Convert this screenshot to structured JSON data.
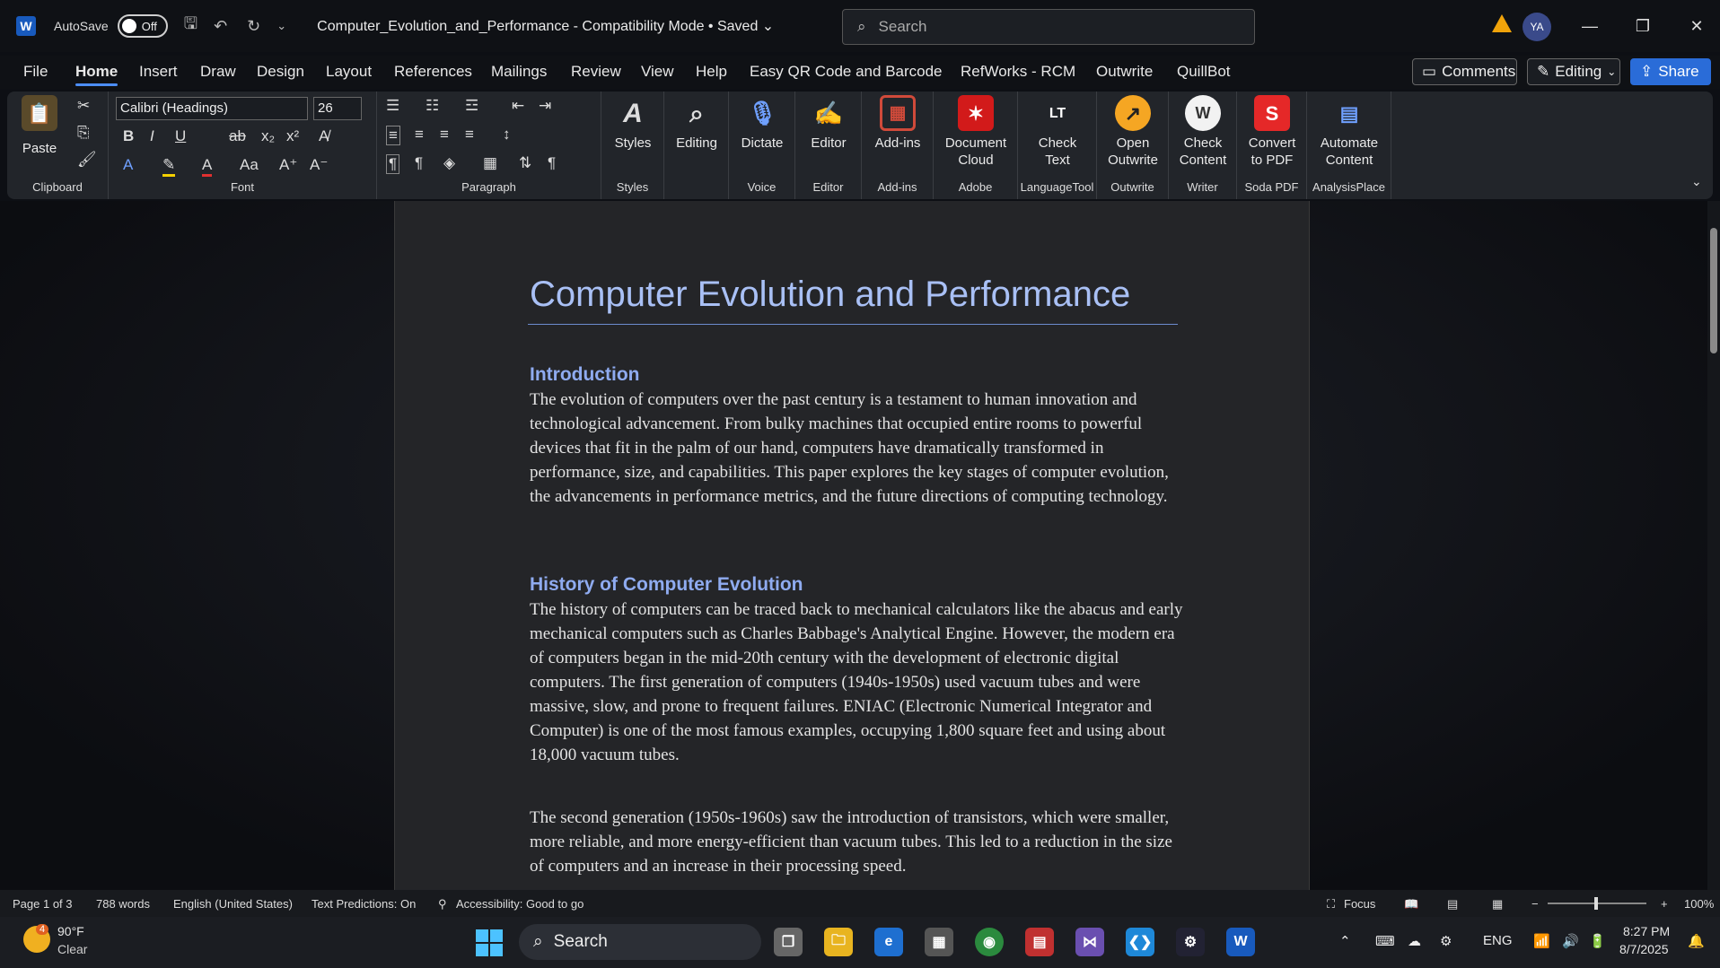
{
  "titlebar": {
    "app_icon": "W",
    "autosave_label": "AutoSave",
    "autosave_state": "Off",
    "doc_title": "Computer_Evolution_and_Performance  -  Compatibility Mode  •  Saved  ⌄",
    "search_placeholder": "Search",
    "user_initials": "YA"
  },
  "menu": {
    "tabs": [
      "File",
      "Home",
      "Insert",
      "Draw",
      "Design",
      "Layout",
      "References",
      "Mailings",
      "Review",
      "View",
      "Help",
      "Easy QR Code and Barcode",
      "RefWorks - RCM",
      "Outwrite",
      "QuillBot"
    ],
    "comments": "Comments",
    "editing": "Editing",
    "share": "Share"
  },
  "ribbon": {
    "clipboard": {
      "paste": "Paste",
      "group": "Clipboard"
    },
    "font": {
      "name": "Calibri (Headings)",
      "size": "26",
      "group": "Font"
    },
    "paragraph": {
      "group": "Paragraph"
    },
    "styles": {
      "label": "Styles",
      "group": "Styles"
    },
    "editing": {
      "label": "Editing"
    },
    "voice": {
      "label": "Dictate",
      "group": "Voice"
    },
    "editor": {
      "label": "Editor",
      "group": "Editor"
    },
    "addins": {
      "label": "Add-ins",
      "group": "Add-ins"
    },
    "adobe": {
      "label1": "Document",
      "label2": "Cloud",
      "group": "Adobe"
    },
    "languagetool": {
      "label1": "Check",
      "label2": "Text",
      "group": "LanguageTool"
    },
    "outwrite": {
      "label1": "Open",
      "label2": "Outwrite",
      "group": "Outwrite"
    },
    "writer": {
      "label1": "Check",
      "label2": "Content",
      "group": "Writer"
    },
    "soda": {
      "label1": "Convert",
      "label2": "to PDF",
      "group": "Soda PDF"
    },
    "analysis": {
      "label1": "Automate",
      "label2": "Content",
      "group": "AnalysisPlace"
    }
  },
  "document": {
    "title": "Computer Evolution and Performance",
    "h_intro": "Introduction",
    "p_intro": "The evolution of computers over the past century is a testament to human innovation and technological advancement. From bulky machines that occupied entire rooms to powerful devices that fit in the palm of our hand, computers have dramatically transformed in performance, size, and capabilities. This paper explores the key stages of computer evolution, the advancements in performance metrics, and the future directions of computing technology.",
    "h_history": "History of Computer Evolution",
    "p_history1": "The history of computers can be traced back to mechanical calculators like the abacus and early mechanical computers such as Charles Babbage's Analytical Engine. However, the modern era of computers began in the mid-20th century with the development of electronic digital computers. The first generation of computers (1940s-1950s) used vacuum tubes and were massive, slow, and prone to frequent failures. ENIAC (Electronic Numerical Integrator and Computer) is one of the most famous examples, occupying 1,800 square feet and using about 18,000 vacuum tubes.",
    "p_history2": "The second generation (1950s-1960s) saw the introduction of transistors, which were smaller, more reliable, and more energy-efficient than vacuum tubes. This led to a reduction in the size of computers and an increase in their processing speed."
  },
  "status": {
    "page": "Page 1 of 3",
    "words": "788 words",
    "language": "English (United States)",
    "predictions": "Text Predictions: On",
    "accessibility": "Accessibility: Good to go",
    "focus": "Focus",
    "zoom": "100%"
  },
  "taskbar": {
    "weather_temp": "90°F",
    "weather_desc": "Clear",
    "weather_badge": "4",
    "search": "Search",
    "lang": "ENG",
    "time": "8:27 PM",
    "date": "8/7/2025"
  }
}
